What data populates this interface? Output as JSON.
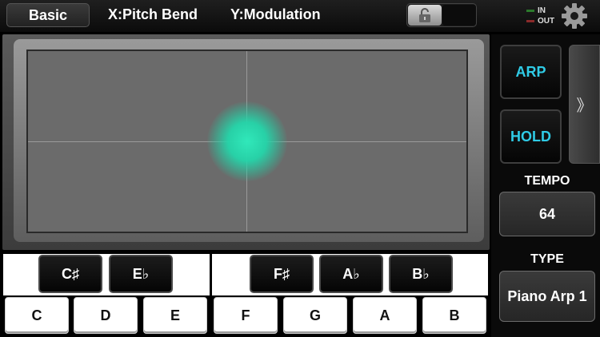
{
  "topbar": {
    "preset_label": "Basic",
    "x_axis_label": "X:Pitch Bend",
    "y_axis_label": "Y:Modulation",
    "lock_icon": "lock-icon",
    "midi_in_label": "IN",
    "midi_out_label": "OUT",
    "settings_icon": "gear-icon"
  },
  "xy_pad": {
    "touch_color": "#30e8ba"
  },
  "side_panel": {
    "arp_label": "ARP",
    "hold_label": "HOLD",
    "expand_label": "》",
    "tempo_label": "TEMPO",
    "tempo_value": "64",
    "type_label": "TYPE",
    "type_value": "Piano Arp 1",
    "accent_color": "#2fcbe6"
  },
  "keyboard": {
    "white_keys": [
      "C",
      "D",
      "E",
      "F",
      "G",
      "A",
      "B"
    ],
    "black_keys": [
      "C♯",
      "E♭",
      "F♯",
      "A♭",
      "B♭"
    ]
  }
}
